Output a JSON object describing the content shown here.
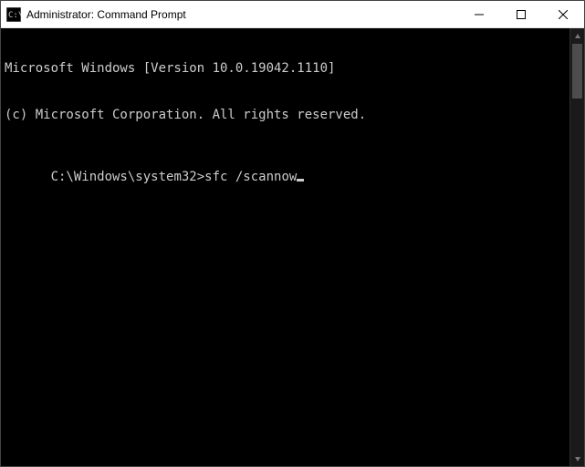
{
  "window": {
    "title": "Administrator: Command Prompt"
  },
  "terminal": {
    "line1": "Microsoft Windows [Version 10.0.19042.1110]",
    "line2": "(c) Microsoft Corporation. All rights reserved.",
    "blank": "",
    "prompt": "C:\\Windows\\system32>",
    "command": "sfc /scannow"
  }
}
